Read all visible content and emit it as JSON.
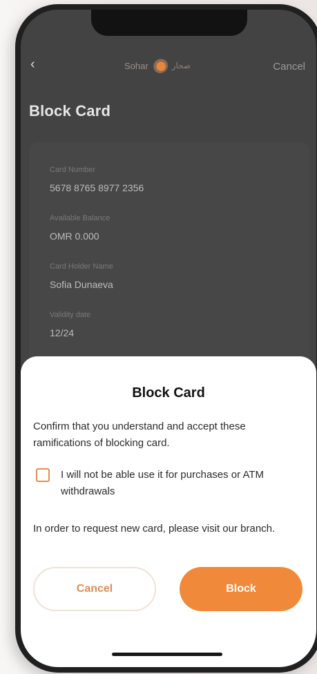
{
  "nav": {
    "back_icon": "chevron-left-icon",
    "logo_en": "Sohar",
    "logo_ar": "صحار",
    "cancel_label": "Cancel"
  },
  "page": {
    "title": "Block Card"
  },
  "card": {
    "fields": [
      {
        "label": "Card Number",
        "value": "5678 8765 8977 2356"
      },
      {
        "label": "Available Balance",
        "value": "OMR 0.000"
      },
      {
        "label": "Card Holder Name",
        "value": "Sofia Dunaeva"
      },
      {
        "label": "Validity date",
        "value": "12/24"
      }
    ]
  },
  "sheet": {
    "title": "Block Card",
    "confirm_text": "Confirm that you understand and accept these ramifications of blocking card.",
    "checkbox_label": "I will not be able use it for purchases or ATM withdrawals",
    "checkbox_checked": false,
    "info_text": "In order to request new card, please visit our branch.",
    "cancel_label": "Cancel",
    "block_label": "Block"
  },
  "colors": {
    "accent": "#f08a3a",
    "overlay": "#434343",
    "sheet_bg": "#ffffff"
  }
}
